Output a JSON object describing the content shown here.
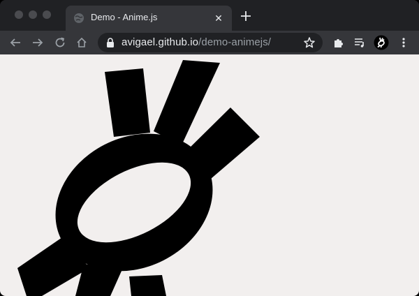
{
  "browser": {
    "tab": {
      "title": "Demo - Anime.js",
      "close_label": "✕"
    },
    "omnibox": {
      "host": "avigael.github.io",
      "path": "/demo-animejs/"
    },
    "icons": [
      "globe-icon",
      "close-icon",
      "plus-icon",
      "back-arrow-icon",
      "forward-arrow-icon",
      "reload-icon",
      "home-icon",
      "lock-icon",
      "star-icon",
      "puzzle-icon",
      "media-control-icon",
      "profile-avatar-icon",
      "kebab-menu-icon"
    ]
  },
  "page": {
    "background": "#f2efee",
    "shape_color": "#000000",
    "logo": "anime.js bitcoin-like stroke logo (animated)"
  },
  "colors": {
    "chrome_dark": "#202124",
    "chrome_toolbar": "#35363a",
    "text_primary": "#e8eaed",
    "text_secondary": "#9aa0a6"
  }
}
